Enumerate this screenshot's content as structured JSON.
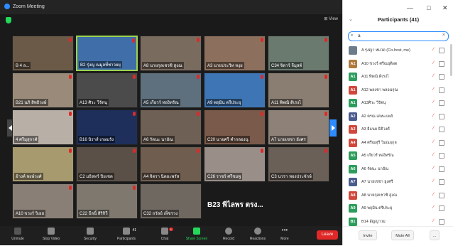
{
  "window": {
    "title": "Zoom Meeting",
    "controls": [
      "—",
      "□",
      "✕"
    ],
    "view_label": "View"
  },
  "tiles": [
    {
      "name": "B 4 ล...",
      "bg": "#6b5a48"
    },
    {
      "name": "B2 รุ่งญ ณมูลที่ชาวยยุ",
      "bg": "#3f6ea8",
      "active": true
    },
    {
      "name": "A8 นายกุลเชวชิ สูงณ",
      "bg": "#7a6b5f"
    },
    {
      "name": "A3 นายประวิท หงุย",
      "bg": "#8c6f5c"
    },
    {
      "name": "C34 จิตาร์ จีมุสต์",
      "bg": "#6a7a6f"
    },
    {
      "name": "B21 นภิ สิทธิวงษ์",
      "bg": "#9a8a7a"
    },
    {
      "name": "A13 ศิวะ วีรัตนุ",
      "bg": "#4b4b4b"
    },
    {
      "name": "A5 เกียวร์ ทองิทรัณ",
      "bg": "#5e6f7d"
    },
    {
      "name": "A9 พฤมิน ตรีประยุ",
      "bg": "#3e76b5"
    },
    {
      "name": "A11 พิพณิ ดิเรงไ",
      "bg": "#8a7e72"
    },
    {
      "name": "4 ศรีมุสุกาศ์",
      "bg": "#b8b0a6"
    },
    {
      "name": "B16 นิราส์ เกษมรัง",
      "bg": "#1d2f5a"
    },
    {
      "name": "A6 รัตนะ นายัณ",
      "bg": "#6f6055"
    },
    {
      "name": "C20 นายศรี คำกลองนุ",
      "bg": "#7a5a4a"
    },
    {
      "name": "A7 นายเชชา ยังศร",
      "bg": "#8e8278"
    },
    {
      "name": "อ้างค์ พงษ์วงศ์",
      "bg": "#a89a6f"
    },
    {
      "name": "C2 มธิลทร์ ปิยเชต",
      "bg": "#5a5048"
    },
    {
      "name": "A4 จิตรา นิตยะพรัส",
      "bg": "#6f5e50"
    },
    {
      "name": "C26 ราชร์ ศรีชมพู",
      "bg": "#9a8f88"
    },
    {
      "name": "C3 นวรา ทองประจักษ์",
      "bg": "#6a6058"
    },
    {
      "name": "A10 ขวงร์ วิเยย",
      "bg": "#8a7f76"
    },
    {
      "name": "C22 ธีลนิ์ สิริกิวี",
      "bg": "#7e786e"
    },
    {
      "name": "",
      "bg": "#1a1a1a",
      "big": "#2 B14 อัญญาวม..."
    },
    {
      "name": "",
      "bg": "#1a1a1a",
      "big": "B23 พิไลพร ตรง..."
    },
    {
      "name": "",
      "bg": "#1a1a1a",
      "big": ""
    }
  ],
  "tiles_extra": [
    {
      "name": "C32 ถวัลย์ เพ็ชรวง",
      "bg": "#6f6860"
    }
  ],
  "toolbar": {
    "unmute": "Unmute",
    "stop_video": "Stop Video",
    "security": "Security",
    "participants": "Participants",
    "participants_count": "41",
    "chat": "Chat",
    "chat_badge": "1",
    "share_screen": "Share Screen",
    "record": "Record",
    "reactions": "Reactions",
    "more": "More",
    "leave": "Leave"
  },
  "panel": {
    "title": "Participants (41)",
    "search_value": "a",
    "invite": "Invite",
    "mute_all": "Mute All",
    "more": "..."
  },
  "participants": [
    {
      "initials": "",
      "name": "A รุ่งญา หมวด (Co-host, me)",
      "color": "#6d7c8a"
    },
    {
      "initials": "A1",
      "name": "A10 ขวงร์ ศรีณยุติผด",
      "color": "#b07a3d"
    },
    {
      "initials": "A1",
      "name": "A11 พิพณิ ดิเรงไ",
      "color": "#2c9d5c"
    },
    {
      "initials": "A1",
      "name": "A12 พลงชา พลอนรุณ",
      "color": "#d0473b"
    },
    {
      "initials": "A1",
      "name": "A13ศิวะ วีรัตนุ",
      "color": "#2c9d5c"
    },
    {
      "initials": "A2",
      "name": "A2 ตรณ เคหะแพล์",
      "color": "#4a5a8e"
    },
    {
      "initials": "A3",
      "name": "A3 ยี่แนย ธิติวงศ์",
      "color": "#d0473b"
    },
    {
      "initials": "A4",
      "name": "A4 ศรีณทุรี วิมณฤกุล",
      "color": "#d0473b"
    },
    {
      "initials": "A5",
      "name": "A5 เกียวร์ ทองิทรัณ",
      "color": "#2c9d5c"
    },
    {
      "initials": "A6",
      "name": "A6 รัตนะ นายัณ",
      "color": "#2c9d5c"
    },
    {
      "initials": "A7",
      "name": "A7 นายเชชา ยูงศรี",
      "color": "#4a5a8e"
    },
    {
      "initials": "A8",
      "name": "A8 นายกุลเชวชิ สูงณ",
      "color": "#d0473b"
    },
    {
      "initials": "A9",
      "name": "A9 พฤมิน ตรีประยุ",
      "color": "#2c9d5c"
    },
    {
      "initials": "B1",
      "name": "B14 อัญญาวม",
      "color": "#2c9d5c"
    }
  ]
}
